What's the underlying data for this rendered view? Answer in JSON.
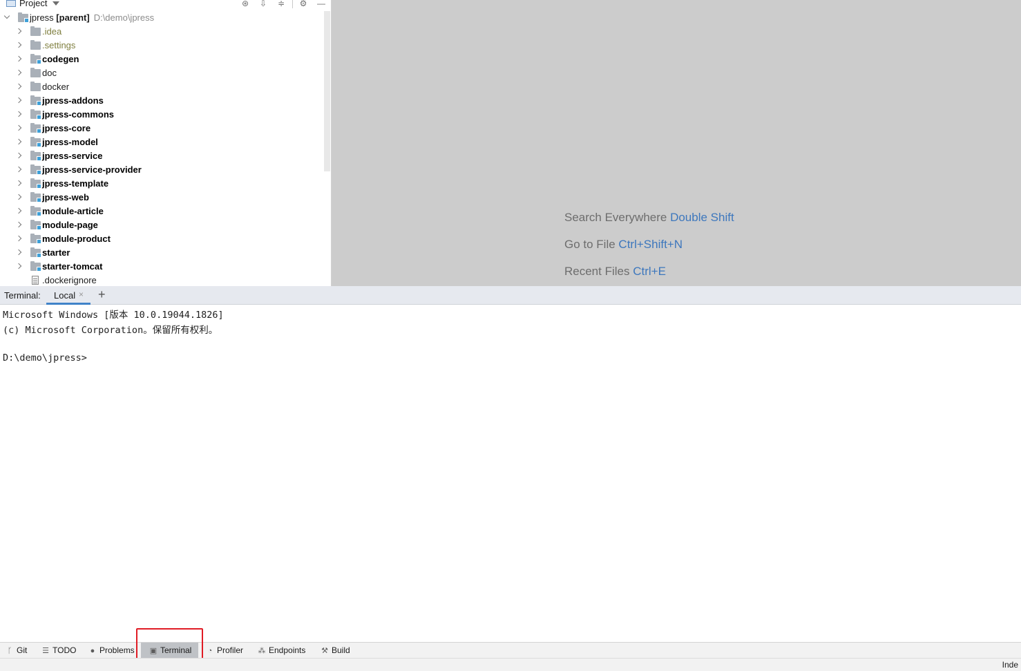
{
  "project_panel": {
    "title": "Project",
    "tree": [
      {
        "label": "jpress [parent]",
        "path": "D:\\demo\\jpress",
        "expanded": true,
        "kind": "module",
        "depth": 0
      },
      {
        "label": ".idea",
        "kind": "folder-dim",
        "depth": 1
      },
      {
        "label": ".settings",
        "kind": "folder-dim",
        "depth": 1
      },
      {
        "label": "codegen",
        "kind": "module",
        "depth": 1
      },
      {
        "label": "doc",
        "kind": "folder",
        "depth": 1
      },
      {
        "label": "docker",
        "kind": "folder",
        "depth": 1
      },
      {
        "label": "jpress-addons",
        "kind": "module",
        "depth": 1
      },
      {
        "label": "jpress-commons",
        "kind": "module",
        "depth": 1
      },
      {
        "label": "jpress-core",
        "kind": "module",
        "depth": 1
      },
      {
        "label": "jpress-model",
        "kind": "module",
        "depth": 1
      },
      {
        "label": "jpress-service",
        "kind": "module",
        "depth": 1
      },
      {
        "label": "jpress-service-provider",
        "kind": "module",
        "depth": 1
      },
      {
        "label": "jpress-template",
        "kind": "module",
        "depth": 1
      },
      {
        "label": "jpress-web",
        "kind": "module",
        "depth": 1
      },
      {
        "label": "module-article",
        "kind": "module",
        "depth": 1
      },
      {
        "label": "module-page",
        "kind": "module",
        "depth": 1
      },
      {
        "label": "module-product",
        "kind": "module",
        "depth": 1
      },
      {
        "label": "starter",
        "kind": "module",
        "depth": 1
      },
      {
        "label": "starter-tomcat",
        "kind": "module",
        "depth": 1
      },
      {
        "label": ".dockerignore",
        "kind": "file",
        "depth": 1
      }
    ]
  },
  "editor_hints": [
    {
      "text": "Search Everywhere ",
      "shortcut": "Double Shift"
    },
    {
      "text": "Go to File ",
      "shortcut": "Ctrl+Shift+N"
    },
    {
      "text": "Recent Files ",
      "shortcut": "Ctrl+E"
    }
  ],
  "terminal": {
    "title": "Terminal:",
    "tab_label": "Local",
    "close_glyph": "×",
    "add_glyph": "+",
    "lines": [
      "Microsoft Windows [版本 10.0.19044.1826]",
      "(c) Microsoft Corporation。保留所有权利。",
      "",
      "D:\\demo\\jpress>"
    ]
  },
  "tool_strip": [
    {
      "label": "Git",
      "icon": "branch-icon"
    },
    {
      "label": "TODO",
      "icon": "list-icon"
    },
    {
      "label": "Problems",
      "icon": "info-icon"
    },
    {
      "label": "Terminal",
      "icon": "terminal-icon",
      "active": true
    },
    {
      "label": "Profiler",
      "icon": "profiler-icon"
    },
    {
      "label": "Endpoints",
      "icon": "endpoints-icon"
    },
    {
      "label": "Build",
      "icon": "hammer-icon"
    }
  ],
  "status_bar": {
    "text": "Inde"
  },
  "colors": {
    "highlight": "#e01b24",
    "shortcut": "#3d77bd",
    "active_tab": "#4083c9"
  }
}
